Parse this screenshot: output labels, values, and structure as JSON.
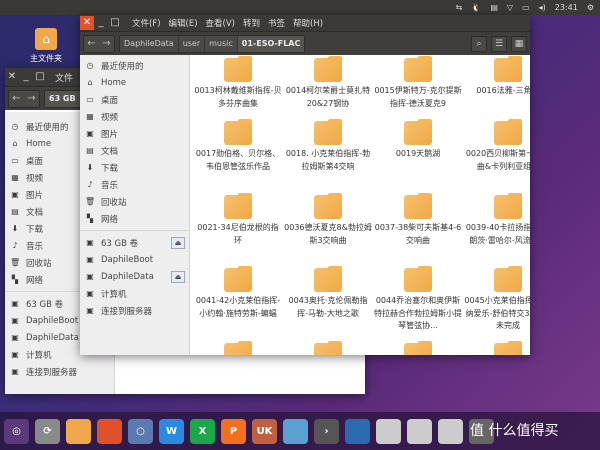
{
  "topbar": {
    "clock": "23:41",
    "icons": [
      "network-icon",
      "tux-icon",
      "keyboard-icon",
      "wifi-icon",
      "battery-icon",
      "volume-icon",
      "power-icon"
    ]
  },
  "desktop": {
    "home_icon_label": "主文件夹"
  },
  "back_window": {
    "title_partial": "文件",
    "path": "63 GB",
    "sidebar": [
      "最近使用的",
      "Home",
      "桌面",
      "视频",
      "图片",
      "文档",
      "下载",
      "音乐",
      "回收站",
      "网络"
    ],
    "devices": [
      "63 GB 卷",
      "DaphileBoot",
      "DaphileData",
      "计算机",
      "连接到服务器"
    ]
  },
  "window": {
    "menu": [
      "文件(F)",
      "编辑(E)",
      "查看(V)",
      "转到",
      "书签",
      "帮助(H)"
    ],
    "breadcrumb": [
      "DaphileData",
      "user",
      "music",
      "01-ESO-FLAC"
    ],
    "sidebar": [
      {
        "label": "最近使用的",
        "icon": "clock-icon",
        "g": "◷"
      },
      {
        "label": "Home",
        "icon": "home-icon",
        "g": "⌂"
      },
      {
        "label": "桌面",
        "icon": "desktop-icon",
        "g": "▭"
      },
      {
        "label": "视频",
        "icon": "video-icon",
        "g": "▦"
      },
      {
        "label": "图片",
        "icon": "picture-icon",
        "g": "▣"
      },
      {
        "label": "文档",
        "icon": "document-icon",
        "g": "▤"
      },
      {
        "label": "下载",
        "icon": "download-icon",
        "g": "⬇"
      },
      {
        "label": "音乐",
        "icon": "music-icon",
        "g": "♪"
      },
      {
        "label": "回收站",
        "icon": "trash-icon",
        "g": "🗑"
      },
      {
        "label": "网络",
        "icon": "network-icon",
        "g": "▚"
      }
    ],
    "devices": [
      {
        "label": "63 GB 卷",
        "eject": true
      },
      {
        "label": "DaphileBoot",
        "eject": false
      },
      {
        "label": "DaphileData",
        "eject": true
      },
      {
        "label": "计算机",
        "eject": false
      },
      {
        "label": "连接到服务器",
        "eject": false
      }
    ],
    "folders": [
      "0013柯林戴维斯指挥-贝多芬序曲集",
      "0014柯尔荣爵士莫扎特20&27钢协",
      "0015伊斯特万-克尔提斯指挥-德沃夏克9",
      "0016法雅-三角帽",
      "0017勋伯格、贝尔格、韦伯恩管弦乐作品",
      "0018. 小克莱伯指挥-勃拉姆斯第4交响",
      "0019天鹅湖",
      "0020西贝柳斯第一交响曲&卡列利亚组曲",
      "0021-34尼伯龙根的指环",
      "0036德沃夏克8&勃拉姆斯3交响曲",
      "0037-38柴可夫斯基4-6交响曲",
      "0039-40卡拉扬指挥-弗朗茨·雷哈尔-风流寡妇",
      "0041-42小克莱伯指挥-小约翰·施特劳斯-蝙蝠",
      "0043奥托·克伦佩勒指挥-马勒-大地之歌",
      "0044乔治塞尔和奥伊斯特拉赫合作勃拉姆斯小提琴管弦协...",
      "0045小克莱伯指挥-维也纳爱乐-舒伯特交3和交8未完成",
      "",
      "",
      "",
      ""
    ]
  },
  "dock": [
    {
      "n": "ubuntu-icon",
      "c": "#5a3a7a",
      "t": "◎"
    },
    {
      "n": "software-updater-icon",
      "c": "#8a8a8a",
      "t": "⟳"
    },
    {
      "n": "files-icon",
      "c": "#f0a848",
      "t": ""
    },
    {
      "n": "firefox-icon",
      "c": "#e0502a",
      "t": ""
    },
    {
      "n": "chromium-icon",
      "c": "#5a7ab0",
      "t": "○"
    },
    {
      "n": "wps-writer-icon",
      "c": "#2a8ae0",
      "t": "W"
    },
    {
      "n": "wps-spreadsheet-icon",
      "c": "#1aa84a",
      "t": "X"
    },
    {
      "n": "wps-presentation-icon",
      "c": "#f07020",
      "t": "P"
    },
    {
      "n": "software-center-icon",
      "c": "#c06040",
      "t": "UK"
    },
    {
      "n": "installer-icon",
      "c": "#5aa0d0",
      "t": ""
    },
    {
      "n": "terminal-icon",
      "c": "#555",
      "t": "›"
    },
    {
      "n": "workspace-icon",
      "c": "#2a6ab0",
      "t": ""
    },
    {
      "n": "drive-icon",
      "c": "#ccc",
      "t": ""
    },
    {
      "n": "drive-icon-2",
      "c": "#ccc",
      "t": ""
    },
    {
      "n": "usb-drive-icon",
      "c": "#ccc",
      "t": ""
    },
    {
      "n": "trash-icon",
      "c": "#666",
      "t": ""
    }
  ],
  "watermark": "值 什么值得买"
}
